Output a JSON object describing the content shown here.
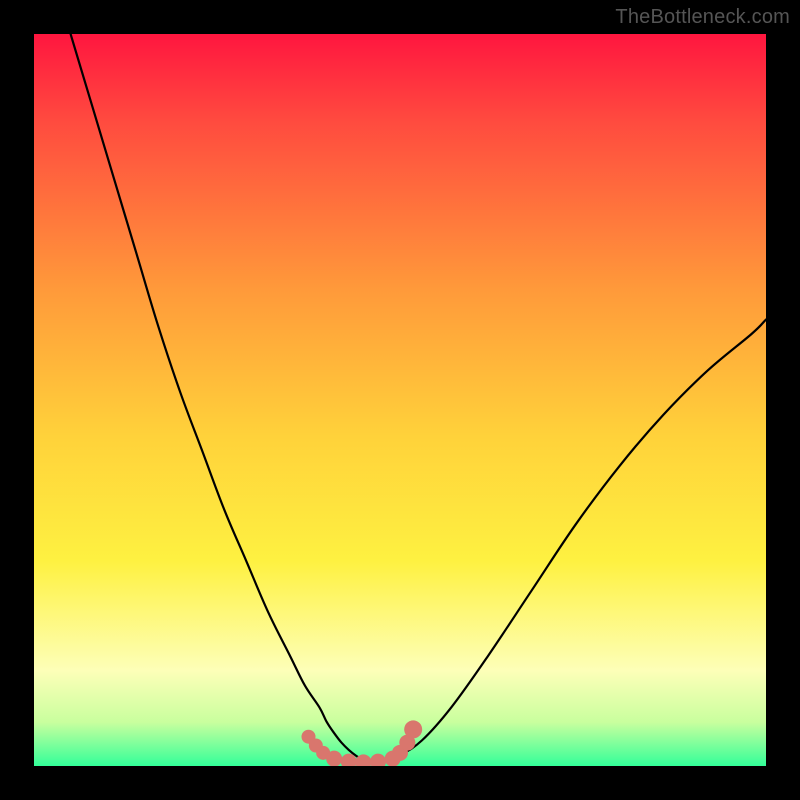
{
  "watermark": "TheBottleneck.com",
  "colors": {
    "bg_frame": "#000000",
    "grad_top": "#ff163f",
    "grad_red2": "#ff4b3f",
    "grad_orange": "#ff9a3a",
    "grad_yellow_mid": "#ffd23a",
    "grad_yellow": "#fef141",
    "grad_pale": "#fdffb8",
    "grad_lightgreen": "#c9ff9e",
    "grad_green": "#33ff99",
    "curve": "#000000",
    "marker": "#d9766d"
  },
  "chart_data": {
    "type": "line",
    "title": "",
    "xlabel": "",
    "ylabel": "",
    "xlim": [
      0,
      100
    ],
    "ylim": [
      0,
      100
    ],
    "series": [
      {
        "name": "bottleneck-curve",
        "x": [
          5,
          8,
          11,
          14,
          17,
          20,
          23,
          26,
          29,
          32,
          35,
          37,
          39,
          40,
          41,
          42,
          43,
          44,
          45,
          46,
          48,
          50,
          53,
          57,
          62,
          68,
          74,
          80,
          86,
          92,
          98,
          100
        ],
        "y": [
          100,
          90,
          80,
          70,
          60,
          51,
          43,
          35,
          28,
          21,
          15,
          11,
          8,
          6,
          4.5,
          3.2,
          2.2,
          1.4,
          0.8,
          0.5,
          0.8,
          1.5,
          3.5,
          8,
          15,
          24,
          33,
          41,
          48,
          54,
          59,
          61
        ]
      }
    ],
    "markers": {
      "name": "highlight-band",
      "x": [
        37.5,
        38.5,
        39.5,
        41,
        43,
        45,
        47,
        49,
        50,
        51,
        51.8
      ],
      "y": [
        4.0,
        2.8,
        1.8,
        1.0,
        0.6,
        0.5,
        0.6,
        1.0,
        1.8,
        3.2,
        5.0
      ],
      "size": [
        7,
        7,
        7,
        8,
        8,
        8,
        8,
        8,
        8,
        8,
        9
      ]
    },
    "gradient_stops": [
      {
        "pos": 0.0,
        "key": "grad_top"
      },
      {
        "pos": 0.12,
        "key": "grad_red2"
      },
      {
        "pos": 0.35,
        "key": "grad_orange"
      },
      {
        "pos": 0.55,
        "key": "grad_yellow_mid"
      },
      {
        "pos": 0.72,
        "key": "grad_yellow"
      },
      {
        "pos": 0.87,
        "key": "grad_pale"
      },
      {
        "pos": 0.94,
        "key": "grad_lightgreen"
      },
      {
        "pos": 1.0,
        "key": "grad_green"
      }
    ]
  }
}
